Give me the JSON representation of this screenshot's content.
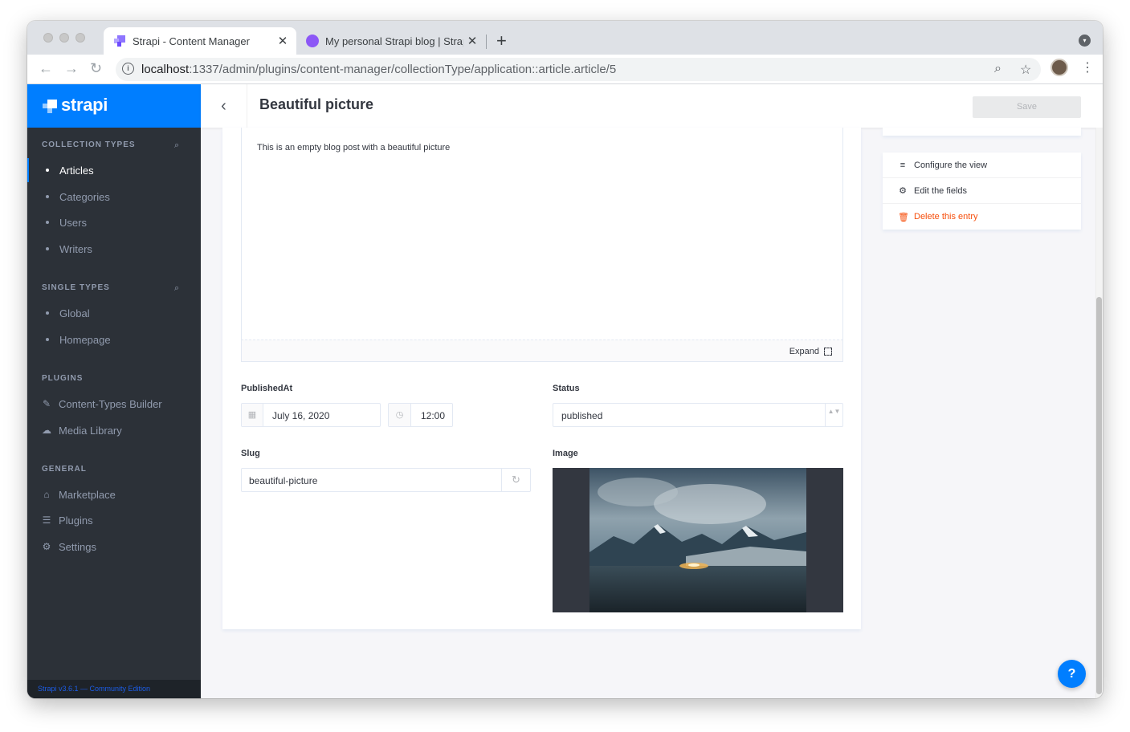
{
  "browser": {
    "tabs": [
      {
        "title": "Strapi - Content Manager",
        "active": true
      },
      {
        "title": "My personal Strapi blog | Strap",
        "active": false
      }
    ],
    "close_glyph": "✕",
    "new_tab_glyph": "+",
    "url_host": "localhost",
    "url_path": ":1337/admin/plugins/content-manager/collectionType/application::article.article/5",
    "icons": {
      "back": "←",
      "forward": "→",
      "reload": "↻",
      "zoom": "⌕",
      "star": "☆",
      "menu": "⋮",
      "info": "i",
      "profile": "▾"
    }
  },
  "brand": {
    "name": "strapi",
    "color": "#007eff"
  },
  "sidebar": {
    "sections": [
      {
        "title": "Collection Types",
        "items": [
          {
            "label": "Articles",
            "active": true
          },
          {
            "label": "Categories"
          },
          {
            "label": "Users"
          },
          {
            "label": "Writers"
          }
        ]
      },
      {
        "title": "Single Types",
        "items": [
          {
            "label": "Global"
          },
          {
            "label": "Homepage"
          }
        ]
      },
      {
        "title": "Plugins",
        "items": [
          {
            "label": "Content-Types Builder",
            "icon": "paint-brush-icon"
          },
          {
            "label": "Media Library",
            "icon": "cloud-upload-icon"
          }
        ]
      },
      {
        "title": "General",
        "items": [
          {
            "label": "Marketplace",
            "icon": "shopping-basket-icon"
          },
          {
            "label": "Plugins",
            "icon": "list-icon"
          },
          {
            "label": "Settings",
            "icon": "gear-icon"
          }
        ]
      }
    ],
    "search_glyph": "⌕",
    "footer": "Strapi v3.6.1 — Community Edition"
  },
  "header": {
    "back_glyph": "‹",
    "title": "Beautiful picture",
    "save_label": "Save"
  },
  "editor": {
    "content": "This is an empty blog post with a beautiful picture",
    "expand_label": "Expand"
  },
  "fields": {
    "published_at": {
      "label": "PublishedAt",
      "date": "July 16, 2020",
      "time": "12:00"
    },
    "status": {
      "label": "Status",
      "value": "published",
      "caret": "▲▼"
    },
    "slug": {
      "label": "Slug",
      "value": "beautiful-picture",
      "regen_glyph": "↻"
    },
    "image": {
      "label": "Image"
    }
  },
  "panel": {
    "configure_label": "Configure the view",
    "edit_fields_label": "Edit the fields",
    "delete_label": "Delete this entry"
  },
  "help_label": "?",
  "colors": {
    "accent": "#007eff",
    "danger": "#f64d0a",
    "sidebar": "#2c3138"
  }
}
